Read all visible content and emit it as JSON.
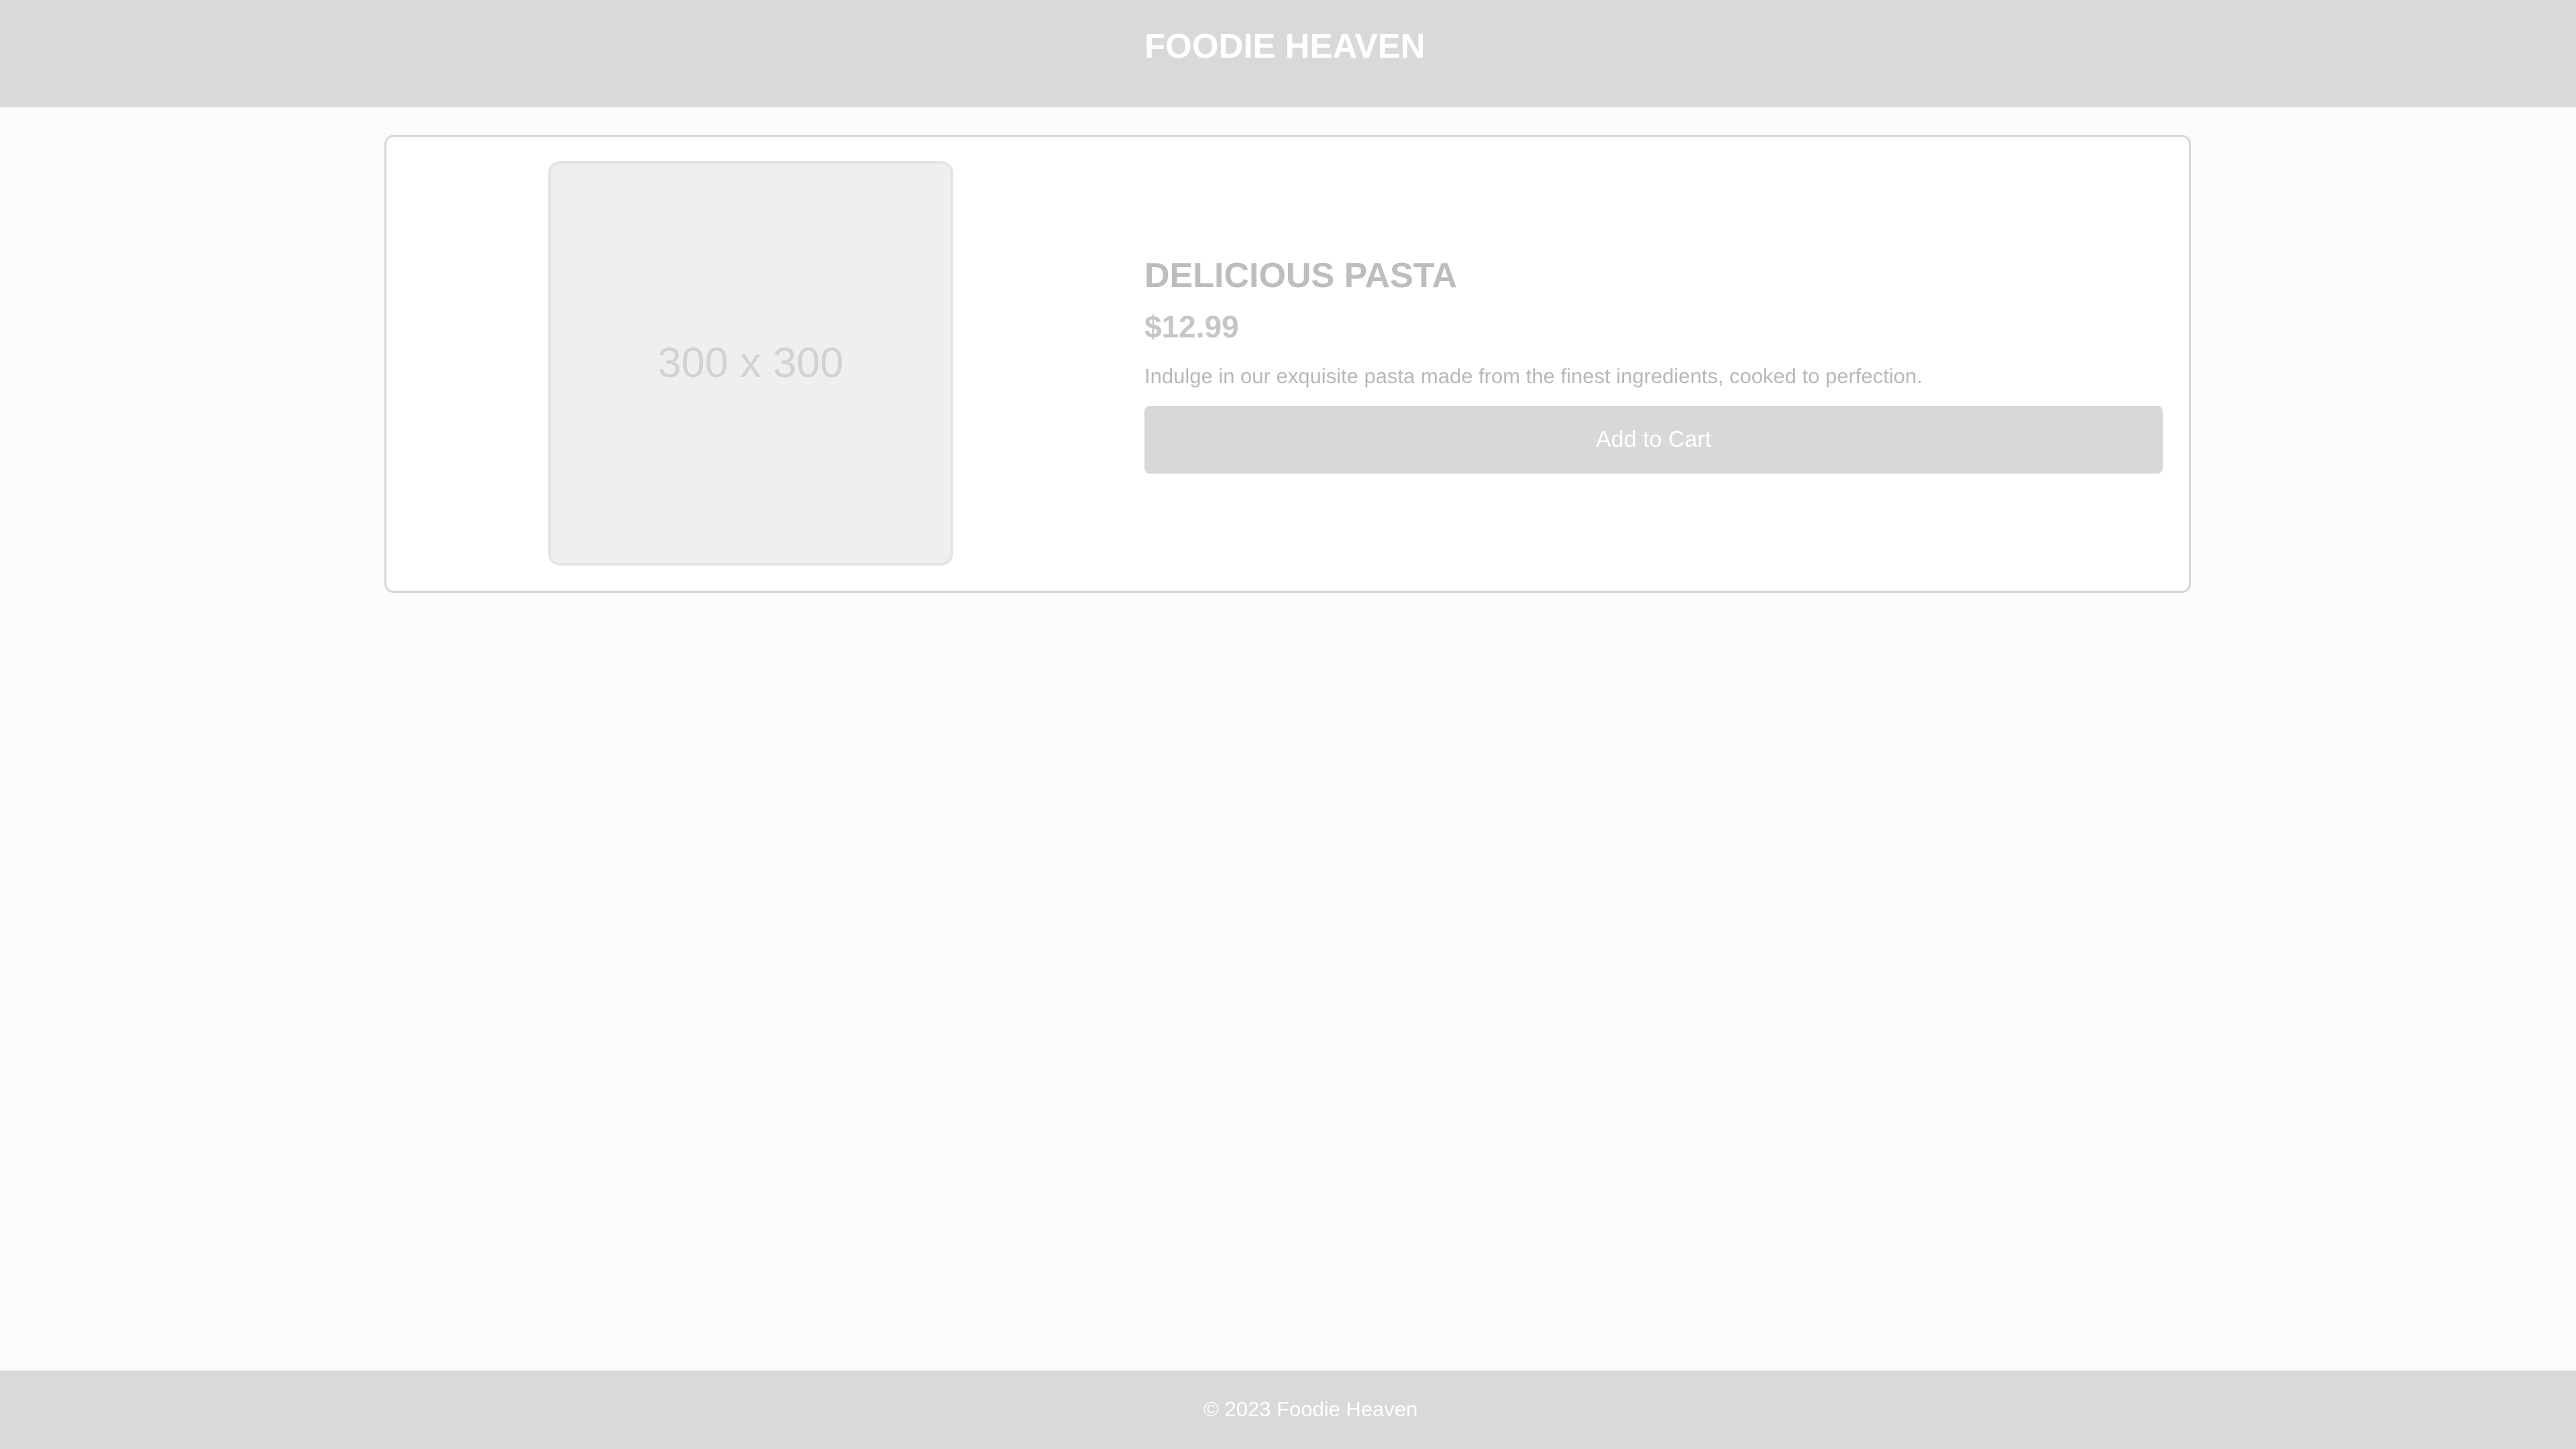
{
  "header": {
    "title": "FOODIE HEAVEN"
  },
  "product": {
    "image_placeholder": "300 x 300",
    "name": "DELICIOUS PASTA",
    "price": "$12.99",
    "description": "Indulge in our exquisite pasta made from the finest ingredients, cooked to perfection.",
    "add_to_cart_label": "Add to Cart"
  },
  "footer": {
    "copyright": "© 2023 Foodie Heaven"
  },
  "colors": {
    "header_background": "#d9d9d9",
    "page_background": "#fbfbfb",
    "button_background": "#d8d8d8",
    "title_text": "#ffffff"
  }
}
